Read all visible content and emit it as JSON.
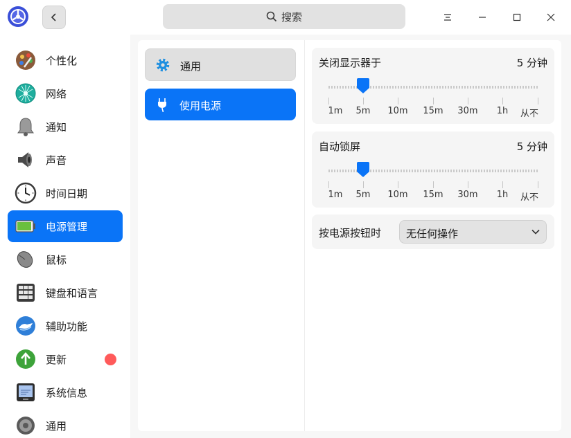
{
  "titlebar": {
    "search_placeholder": "搜索"
  },
  "sidebar": {
    "items": [
      {
        "label": "个性化",
        "icon": "personalization-icon"
      },
      {
        "label": "网络",
        "icon": "network-icon"
      },
      {
        "label": "通知",
        "icon": "bell-icon"
      },
      {
        "label": "声音",
        "icon": "speaker-icon"
      },
      {
        "label": "时间日期",
        "icon": "clock-icon"
      },
      {
        "label": "电源管理",
        "icon": "battery-icon",
        "active": true
      },
      {
        "label": "鼠标",
        "icon": "mouse-icon"
      },
      {
        "label": "键盘和语言",
        "icon": "keyboard-icon"
      },
      {
        "label": "辅助功能",
        "icon": "accessibility-icon"
      },
      {
        "label": "更新",
        "icon": "update-icon",
        "badge": true
      },
      {
        "label": "系统信息",
        "icon": "system-info-icon"
      },
      {
        "label": "通用",
        "icon": "general-gear-icon"
      }
    ]
  },
  "subnav": {
    "general_label": "通用",
    "power_label": "使用电源"
  },
  "settings": {
    "screen_off": {
      "title": "关闭显示器于",
      "value": "5 分钟",
      "ticks": [
        "1m",
        "5m",
        "10m",
        "15m",
        "30m",
        "1h",
        "从不"
      ],
      "selected_index": 1
    },
    "auto_lock": {
      "title": "自动锁屏",
      "value": "5 分钟",
      "ticks": [
        "1m",
        "5m",
        "10m",
        "15m",
        "30m",
        "1h",
        "从不"
      ],
      "selected_index": 1
    },
    "power_button": {
      "label": "按电源按钮时",
      "value": "无任何操作"
    }
  },
  "colors": {
    "accent": "#0a74f7",
    "badge": "#ff5a5a"
  }
}
